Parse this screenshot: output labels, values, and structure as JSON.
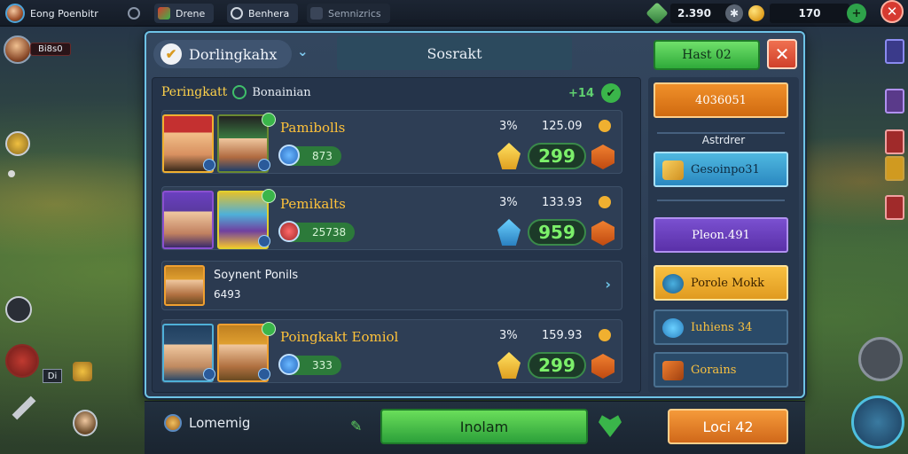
{
  "topbar": {
    "player_name": "Eong Poenbitr",
    "tabs": [
      {
        "label": "Drene"
      },
      {
        "label": "Benhera"
      },
      {
        "label": "Semnizrics"
      }
    ],
    "gems": "2.390",
    "coins": "170"
  },
  "hud_left": {
    "name_tag": "Bi8s0",
    "item_tag": "Di"
  },
  "panel": {
    "active_tab": "Dorlingkahx",
    "title_tab": "Sosrakt",
    "top_button": "Hast 02",
    "list_title": "Peringkatt",
    "list_subtitle": "Bonainian",
    "list_count": "+14",
    "rows": [
      {
        "name": "Pamibolls",
        "stat": "873",
        "pct": "3%",
        "time": "125.09",
        "score": "299"
      },
      {
        "name": "Pemikalts",
        "stat": "25738",
        "pct": "3%",
        "time": "133.93",
        "score": "959"
      },
      {
        "name": "Soynent Ponils",
        "sub": "6493"
      },
      {
        "name": "Poingkakt Eomiol",
        "stat": "333",
        "pct": "3%",
        "time": "159.93",
        "score": "299"
      }
    ],
    "side": {
      "top_button": "4036051",
      "section_label": "Astrdrer",
      "blue_button": "Gesoinpo31",
      "purple_button": "Pleon.491",
      "yellow_button": "Porole Mokk",
      "navy_button_1": "Iuhiens 34",
      "navy_button_2": "Gorains"
    }
  },
  "bottom": {
    "user": "Lomemig",
    "main_button": "Inolam",
    "right_button": "Loci 42"
  }
}
